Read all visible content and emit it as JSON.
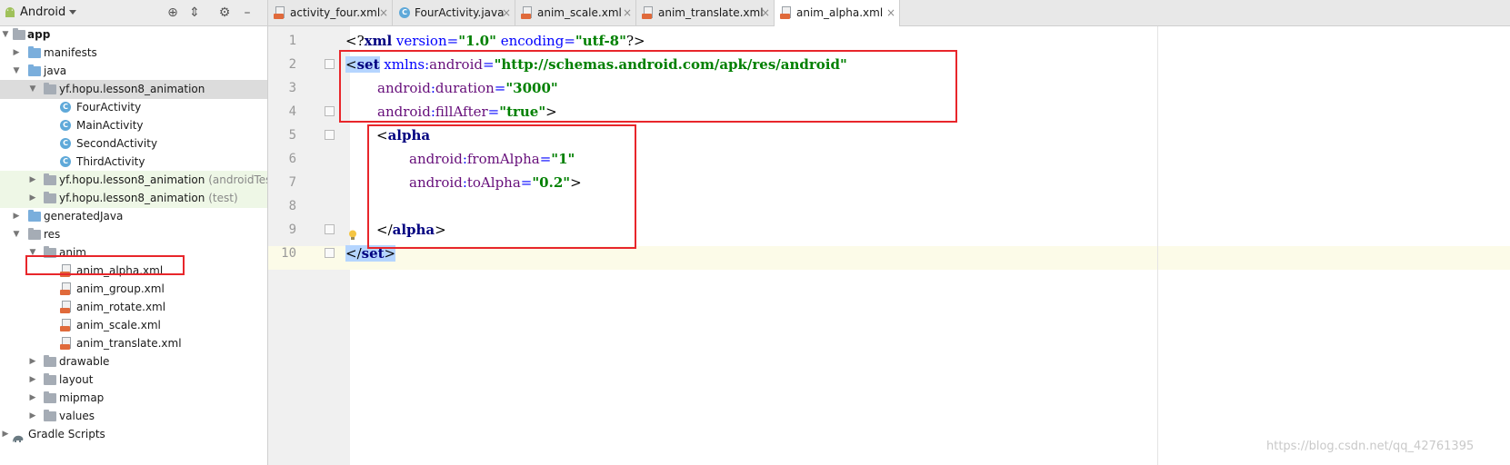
{
  "sidebar": {
    "view_label": "Android",
    "colors": {
      "folder": "#7aaedc",
      "class": "#5fa9d9",
      "xml_tag": "#e06a3b",
      "selection": "#dcdcdc",
      "test_bg": "#eef7e6"
    },
    "tree": [
      {
        "label": "app",
        "icon": "module-folder-icon",
        "bold": true
      },
      {
        "label": "manifests",
        "icon": "folder-icon"
      },
      {
        "label": "java",
        "icon": "folder-icon"
      },
      {
        "label": "yf.hopu.lesson8_animation",
        "icon": "package-icon",
        "selected": true
      },
      {
        "label": "FourActivity",
        "icon": "class-icon"
      },
      {
        "label": "MainActivity",
        "icon": "class-icon"
      },
      {
        "label": "SecondActivity",
        "icon": "class-icon"
      },
      {
        "label": "ThirdActivity",
        "icon": "class-icon"
      },
      {
        "label": "yf.hopu.lesson8_animation",
        "suffix": "(androidTest)",
        "icon": "package-icon"
      },
      {
        "label": "yf.hopu.lesson8_animation",
        "suffix": "(test)",
        "icon": "package-icon"
      },
      {
        "label": "generatedJava",
        "icon": "generated-folder-icon"
      },
      {
        "label": "res",
        "icon": "resource-folder-icon"
      },
      {
        "label": "anim",
        "icon": "folder-icon"
      },
      {
        "label": "anim_alpha.xml",
        "icon": "xml-file-icon"
      },
      {
        "label": "anim_group.xml",
        "icon": "xml-file-icon"
      },
      {
        "label": "anim_rotate.xml",
        "icon": "xml-file-icon"
      },
      {
        "label": "anim_scale.xml",
        "icon": "xml-file-icon"
      },
      {
        "label": "anim_translate.xml",
        "icon": "xml-file-icon"
      },
      {
        "label": "drawable",
        "icon": "folder-icon"
      },
      {
        "label": "layout",
        "icon": "folder-icon"
      },
      {
        "label": "mipmap",
        "icon": "folder-icon"
      },
      {
        "label": "values",
        "icon": "folder-icon"
      },
      {
        "label": "Gradle Scripts",
        "icon": "gradle-icon"
      }
    ]
  },
  "tabs": [
    {
      "label": "activity_four.xml",
      "icon": "xml-file-icon"
    },
    {
      "label": "FourActivity.java",
      "icon": "class-icon"
    },
    {
      "label": "anim_scale.xml",
      "icon": "xml-file-icon"
    },
    {
      "label": "anim_translate.xml",
      "icon": "xml-file-icon"
    },
    {
      "label": "anim_alpha.xml",
      "icon": "xml-file-icon",
      "active": true
    }
  ],
  "close_glyph": "×",
  "editor": {
    "line_numbers": [
      "1",
      "2",
      "3",
      "4",
      "5",
      "6",
      "7",
      "8",
      "9",
      "10"
    ],
    "lines": {
      "l1": {
        "open": "<?",
        "name": "xml",
        "a1": " version=",
        "v1": "\"1.0\"",
        "a2": " encoding=",
        "v2": "\"utf-8\"",
        "close": "?>"
      },
      "l2": {
        "open": "<",
        "name": "set",
        "attr_ns": " xmlns",
        "attr_colon": ":",
        "attr_name": "android",
        "eq": "=",
        "value": "\"http://schemas.android.com/apk/res/android\""
      },
      "l3": {
        "ns": "android",
        "colon": ":",
        "attr": "duration",
        "eq": "=",
        "value": "\"3000\""
      },
      "l4": {
        "ns": "android",
        "colon": ":",
        "attr": "fillAfter",
        "eq": "=",
        "value": "\"true\"",
        "close": ">"
      },
      "l5": {
        "open": "<",
        "name": "alpha"
      },
      "l6": {
        "ns": "android",
        "colon": ":",
        "attr": "fromAlpha",
        "eq": "=",
        "value": "\"1\""
      },
      "l7": {
        "ns": "android",
        "colon": ":",
        "attr": "toAlpha",
        "eq": "=",
        "value": "\"0.2\"",
        "close": ">"
      },
      "l9": {
        "open": "</",
        "name": "alpha",
        "close": ">"
      },
      "l10": {
        "open": "</",
        "name": "set",
        "close": ">"
      }
    },
    "colors": {
      "tag": "#000080",
      "attr": "#660e7a",
      "value": "#008000",
      "highlight": "#b5d5ff",
      "annotation": "#e8262b"
    }
  },
  "watermark": "https://blog.csdn.net/qq_42761395"
}
